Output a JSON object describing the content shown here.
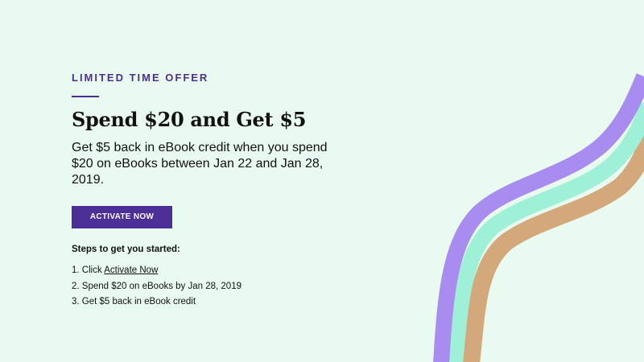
{
  "promo": {
    "eyebrow": "LIMITED TIME OFFER",
    "headline": "Spend $20 and Get $5",
    "description": "Get $5 back in eBook credit when you spend $20 on eBooks between Jan 22 and Jan 28, 2019.",
    "cta_label": "ACTIVATE NOW"
  },
  "steps": {
    "title": "Steps to get you started:",
    "items": [
      {
        "prefix": "1. Click ",
        "link": "Activate Now"
      },
      {
        "text": "2. Spend $20 on eBooks by Jan 28, 2019"
      },
      {
        "text": "3. Get $5 back in eBook credit"
      }
    ]
  },
  "colors": {
    "background": "#e9fbf1",
    "accent": "#4b2f96",
    "ribbon_purple": "#a98cf0",
    "ribbon_mint": "#9ef0d6",
    "ribbon_kraft": "#d3a87a"
  }
}
